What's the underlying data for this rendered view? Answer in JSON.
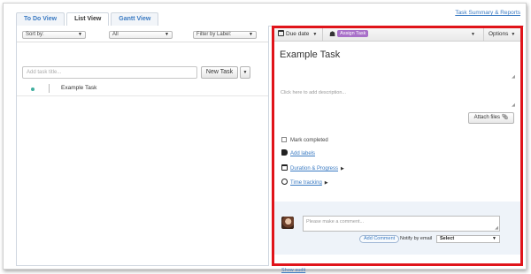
{
  "header": {
    "summary_link": "Task Summary & Reports"
  },
  "tabs": [
    {
      "label": "To Do View"
    },
    {
      "label": "List View",
      "active": true
    },
    {
      "label": "Gantt View"
    }
  ],
  "filters": {
    "sort_by": "Sort by:",
    "scope": "All",
    "label_filter": "Filter by Label:"
  },
  "task_entry": {
    "placeholder": "Add task title...",
    "new_task_label": "New Task"
  },
  "tasks": [
    {
      "name": "Example Task",
      "status_color": "#3fae9e"
    }
  ],
  "detail": {
    "toolbar": {
      "due_date_label": "Due date",
      "assign_label": "Assign Task",
      "options_label": "Options"
    },
    "title": "Example Task",
    "description_placeholder": "Click here to add description...",
    "attach_label": "Attach files",
    "mark_completed_label": "Mark completed",
    "add_labels_label": "Add labels",
    "duration_label": "Duration & Progress",
    "time_tracking_label": "Time tracking",
    "comment_placeholder": "Please make a comment...",
    "add_comment_label": "Add Comment",
    "notify_label": "Notify by email",
    "notify_value": "Select",
    "show_audit_label": "Show audit"
  },
  "colors": {
    "highlight_border": "#e0141a",
    "assign_badge": "#a970c9",
    "link": "#3a7ac2"
  },
  "icons": [
    "calendar-icon",
    "tag-icon",
    "paperclip-icon",
    "label-icon",
    "duration-icon",
    "clock-icon",
    "chevron-down-icon",
    "triangle-right-icon"
  ]
}
